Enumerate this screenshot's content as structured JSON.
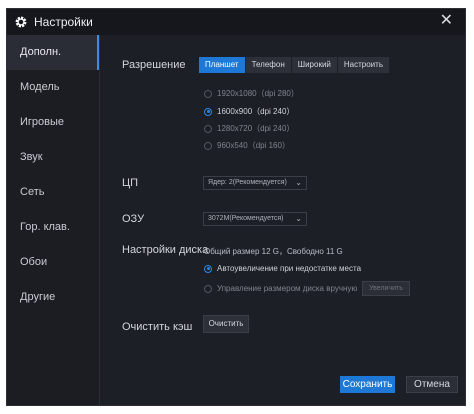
{
  "window": {
    "title": "Настройки",
    "close_label": "✕"
  },
  "sidebar": {
    "items": [
      {
        "label": "Дополн."
      },
      {
        "label": "Модель"
      },
      {
        "label": "Игровые"
      },
      {
        "label": "Звук"
      },
      {
        "label": "Сеть"
      },
      {
        "label": "Гор. клав."
      },
      {
        "label": "Обои"
      },
      {
        "label": "Другие"
      }
    ],
    "active_index": 0
  },
  "resolution": {
    "label": "Разрешение",
    "tabs": [
      "Планшет",
      "Телефон",
      "Широкий",
      "Настроить"
    ],
    "active_tab": 0,
    "options": [
      "1920x1080（dpi 280）",
      "1600x900（dpi 240）",
      "1280x720（dpi 240）",
      "960x540（dpi 160）"
    ],
    "selected_option": 1
  },
  "cpu": {
    "label": "ЦП",
    "value": "Ядер: 2(Рекомендуется)"
  },
  "ram": {
    "label": "ОЗУ",
    "value": "3072M(Рекомендуется)"
  },
  "disk": {
    "label": "Настройки диска",
    "info": "Общий размер 12 G，Свободно 11 G",
    "options": [
      "Автоувеличение при недостатке места",
      "Управление размером диска вручную"
    ],
    "selected_option": 0,
    "increase_label": "Увеличить"
  },
  "cache": {
    "label": "Очистить кэш",
    "button_label": "Очистить"
  },
  "footer": {
    "save_label": "Сохранить",
    "cancel_label": "Отмена"
  },
  "colors": {
    "accent": "#1e78d6",
    "background": "#1d1f26",
    "titlebar": "#15171c"
  }
}
